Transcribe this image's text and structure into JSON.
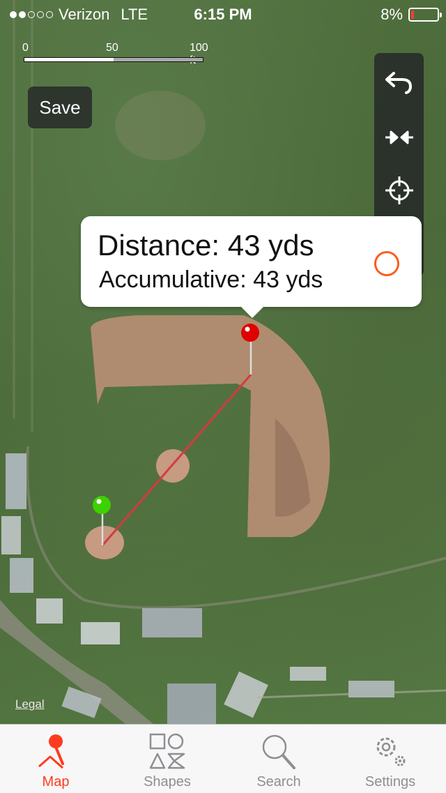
{
  "status_bar": {
    "carrier": "Verizon",
    "network": "LTE",
    "time": "6:15 PM",
    "battery": "8%",
    "signal_dots_filled": 2,
    "signal_dots_total": 5
  },
  "scale": {
    "labels": [
      "0",
      "50",
      "100 ft"
    ]
  },
  "save_button": "Save",
  "toolbar": {
    "icons": [
      "undo-icon",
      "collapse-arrows-icon",
      "crosshair-locate-icon",
      "walking-person-icon"
    ]
  },
  "callout": {
    "distance": "Distance: 43 yds",
    "accumulative": "Accumulative: 43 yds"
  },
  "map": {
    "legal": "Legal",
    "start_pin_color": "#3cd200",
    "end_pin_color": "#e00000",
    "line_color": "#d23c3c"
  },
  "tabs": [
    {
      "label": "Map",
      "icon": "map-pin-icon",
      "active": true
    },
    {
      "label": "Shapes",
      "icon": "shapes-icon",
      "active": false
    },
    {
      "label": "Search",
      "icon": "search-icon",
      "active": false
    },
    {
      "label": "Settings",
      "icon": "settings-gear-icon",
      "active": false
    }
  ],
  "colors": {
    "accent": "#ff3b1f",
    "tab_inactive": "#8e8e93"
  }
}
